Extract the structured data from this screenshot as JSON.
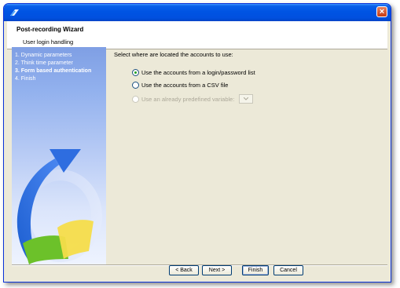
{
  "window": {
    "close_symbol": "×"
  },
  "header": {
    "title": "Post-recording Wizard",
    "subtitle": "User login handling"
  },
  "sidebar": {
    "steps": [
      {
        "label": "1. Dynamic parameters",
        "active": false
      },
      {
        "label": "2. Think time parameter",
        "active": false
      },
      {
        "label": "3. Form based authentication",
        "active": true
      },
      {
        "label": "4. Finish",
        "active": false
      }
    ]
  },
  "content": {
    "prompt": "Select where are located the accounts to use:",
    "options": [
      {
        "label": "Use the accounts from a login/password list",
        "checked": true,
        "enabled": true
      },
      {
        "label": "Use the accounts from a CSV file",
        "checked": false,
        "enabled": true
      },
      {
        "label": "Use an already predefined variable:",
        "checked": false,
        "enabled": false
      }
    ],
    "variable_select": {
      "value": ""
    }
  },
  "buttons": {
    "back": "< Back",
    "next": "Next >",
    "finish": "Finish",
    "cancel": "Cancel"
  },
  "icons": {
    "title": "wizard-icon",
    "close": "close-icon",
    "dropdown": "chevron-down-icon",
    "graphic": "refresh-arrow-graphic"
  }
}
